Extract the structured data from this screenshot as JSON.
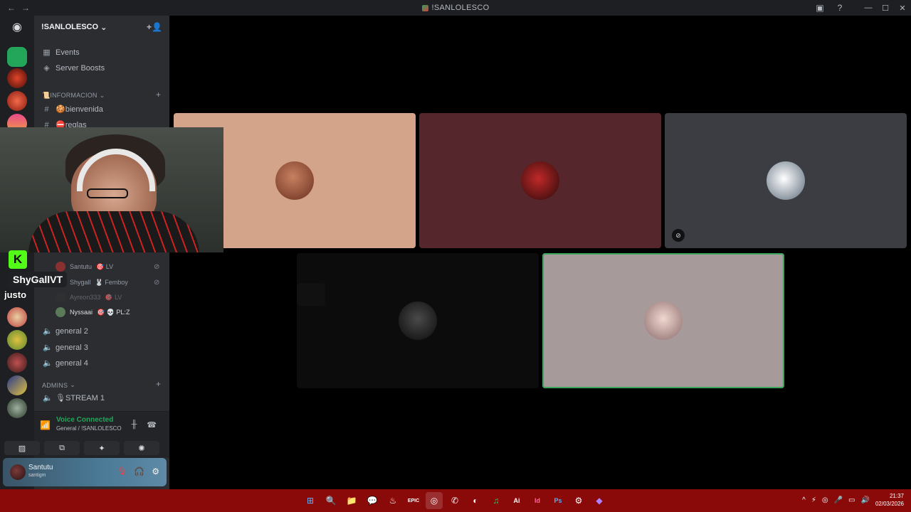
{
  "window": {
    "title": "!SANLOLESCO",
    "back": "←",
    "forward": "→",
    "inbox_icon": "▣",
    "help_icon": "?",
    "minimize": "—",
    "maximize": "☐",
    "close": "✕"
  },
  "rail": {
    "home_icon": "◉",
    "servers": [
      {
        "name": "server-green",
        "color": "#23a55a"
      },
      {
        "name": "server-red-dark",
        "color": "#8a2518"
      },
      {
        "name": "server-red-logo",
        "color": "#c0392b"
      },
      {
        "name": "server-sunset",
        "color": "#e06c4a"
      }
    ]
  },
  "server": {
    "name": "!SANLOLESCO",
    "chevron": "⌄",
    "invite_icon": "+👤",
    "items": [
      {
        "icon": "▦",
        "label": "Events"
      },
      {
        "icon": "◈",
        "label": "Server Boosts"
      }
    ],
    "categories": {
      "info": "📜INFORMACION",
      "admins": "ADMINS"
    },
    "text_channels": [
      {
        "label": "🍪bienvenida"
      },
      {
        "label": "⛔reglas"
      }
    ],
    "voice_members": [
      {
        "name": "Santutu",
        "tag": "🎯 LV",
        "color": "#8a3030"
      },
      {
        "name": "Shygall",
        "tag": "🐰 Femboy",
        "color": "#a0a0a0"
      },
      {
        "name": "Ayreon333",
        "tag": "🎯 LV",
        "color": "#333"
      },
      {
        "name": "Nyssaai",
        "tag": "🎯 💀 PL:Z",
        "color": "#5a7a5a"
      }
    ],
    "voice_channels": [
      {
        "label": "general 2"
      },
      {
        "label": "general 3"
      },
      {
        "label": "general 4"
      }
    ],
    "admin_channels": [
      {
        "label": "🎙STREAM 1"
      }
    ],
    "plus": "+"
  },
  "voice_panel": {
    "title": "Voice Connected",
    "subtitle": "General / !SANLOLESCO",
    "buttons": [
      "▨",
      "⧉",
      "✦",
      "✺"
    ]
  },
  "user": {
    "name": "Santutu",
    "status": "santigm",
    "mic_icon": "🎙",
    "headset_icon": "🎧",
    "settings_icon": "⚙"
  },
  "stage": {
    "tiles": [
      {
        "name": "tile-1",
        "bg": "#d4a48a",
        "avatar": "#8a4a30",
        "muted": false,
        "speaking": false
      },
      {
        "name": "tile-2",
        "bg": "#55272d",
        "avatar": "#b22a2a",
        "muted": false,
        "speaking": false
      },
      {
        "name": "tile-3",
        "bg": "#3c3d42",
        "avatar": "#e0e0e0",
        "muted": true,
        "speaking": false
      },
      {
        "name": "tile-4",
        "bg": "#0a0a0a",
        "avatar": "#2a2a2a",
        "muted": false,
        "speaking": false
      },
      {
        "name": "tile-5",
        "bg": "#a69b9a",
        "avatar": "#d0b0a8",
        "muted": false,
        "speaking": true
      }
    ],
    "mute_icon": "🚫"
  },
  "overlay": {
    "streamer_name": "ShyGallVT",
    "k_logo": "K",
    "justo": "justo"
  },
  "taskbar": {
    "apps": [
      "⊞",
      "🔍",
      "📁",
      "💬",
      "♨",
      "EPIC",
      "◎",
      "✆",
      "◐",
      "♫",
      "Ai",
      "Id",
      "Ps",
      "⚙",
      "◆"
    ],
    "tray": [
      "^",
      "⚡",
      "◎",
      "🎤",
      "▭",
      "🔊"
    ],
    "time": "21:37",
    "date": "02/03/2026"
  }
}
